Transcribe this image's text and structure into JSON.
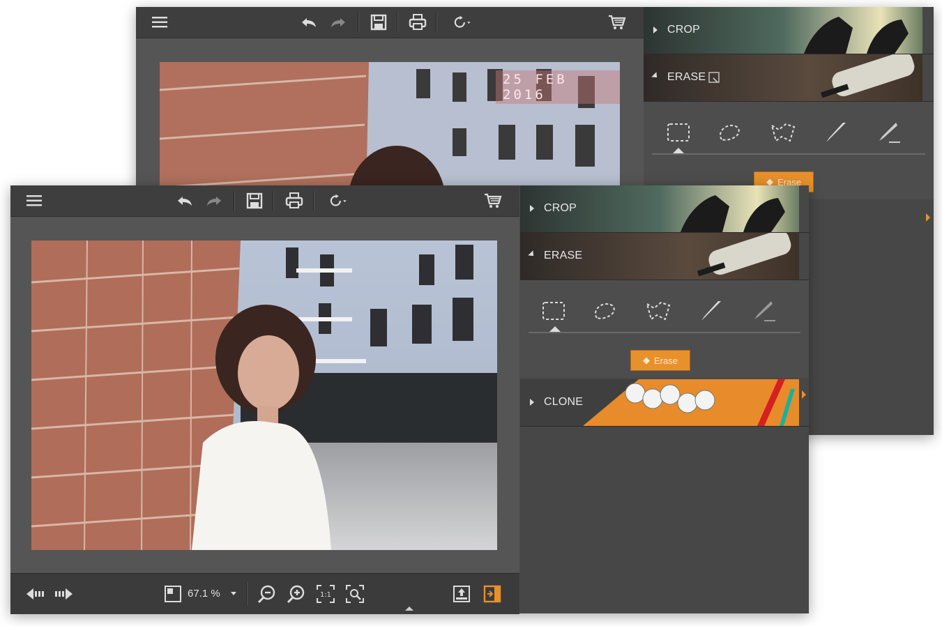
{
  "back_window": {
    "photo_stamp": "25 FEB 2016",
    "panel": {
      "crop_label": "CROP",
      "erase_label": "ERASE",
      "erase_button_label": "Erase"
    }
  },
  "front_window": {
    "panel": {
      "crop_label": "CROP",
      "erase_label": "ERASE",
      "erase_button_label": "Erase",
      "clone_label": "CLONE"
    },
    "status": {
      "zoom_value": "67.1 %"
    }
  },
  "colors": {
    "accent": "#e8912c",
    "toolbar_bg": "#3e3e3e",
    "panel_bg": "#474747"
  },
  "icons": [
    "menu-icon",
    "undo-icon",
    "redo-icon",
    "save-icon",
    "print-icon",
    "rotate-icon",
    "cart-icon",
    "rect-select-icon",
    "lasso-icon",
    "polygon-lasso-icon",
    "brush-icon",
    "eraser-brush-icon",
    "prev-icon",
    "next-icon",
    "zoom-out-icon",
    "zoom-in-icon",
    "actual-size-icon",
    "fit-icon",
    "export-icon",
    "panel-toggle-icon"
  ]
}
